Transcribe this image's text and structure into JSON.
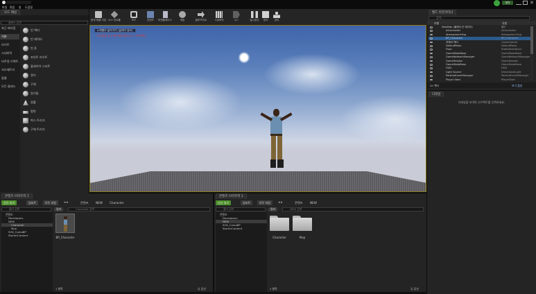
{
  "menu": {
    "items": [
      "파일",
      "편집",
      "창",
      "도움말"
    ]
  },
  "titlebar": {
    "user_badge": "제작"
  },
  "tabs": {
    "modes": "모드 패널",
    "outliner": "월드 아웃라이너",
    "details": "디테일",
    "content_browser_1": "콘텐츠 브라우저 1",
    "content_browser_2": "콘텐츠 브라우저 1"
  },
  "toolbar": {
    "buttons": [
      {
        "label": "현재 레벨 저장",
        "icon": "save-icon"
      },
      {
        "label": "소스 컨트롤",
        "icon": "source-control-icon"
      },
      {
        "label": "모드",
        "icon": "modes-icon"
      },
      {
        "label": "콘텐츠",
        "icon": "content-icon"
      },
      {
        "label": "마켓플레이스",
        "icon": "marketplace-icon"
      },
      {
        "label": "세팅",
        "icon": "settings-icon"
      },
      {
        "label": "블루프린트",
        "icon": "blueprint-icon"
      },
      {
        "label": "시네마틱",
        "icon": "cinematic-icon"
      },
      {
        "label": "빌드",
        "icon": "build-icon"
      },
      {
        "label": "일시정지",
        "icon": "pause-icon"
      },
      {
        "label": "정지",
        "icon": "stop-icon"
      },
      {
        "label": "빙의",
        "icon": "possess-icon"
      }
    ]
  },
  "modes_panel": {
    "search_placeholder": "클래스 검색",
    "categories": [
      "최근 배치함",
      "기본",
      "라이트",
      "시네마틱",
      "비주얼 이펙트",
      "지오메트리",
      "볼륨",
      "모든 클래스"
    ],
    "place_items": [
      "빈 액터",
      "빈 캐릭터",
      "빈 폰",
      "포인트 라이트",
      "플레이어 스타트",
      "큐브",
      "구체",
      "원기둥",
      "원뿔",
      "평면",
      "박스 트리거",
      "구체 트리거"
    ]
  },
  "viewport": {
    "notice": "라이팅을 다시 빌드해야 합니다 (1 오브젝트)",
    "button": "◂ 레벨로 돌아가기 (플레이 종료)"
  },
  "outliner": {
    "search_placeholder": "검색...",
    "col_label": "라벨",
    "col_type": "유형",
    "rows": [
      {
        "name": "NewMap (플레이 인 에디터)",
        "type": "월드"
      },
      {
        "name": "AIController",
        "type": "AIController"
      },
      {
        "name": "AtmosphericFog",
        "type": "AtmosphericFog"
      },
      {
        "name": "BP_Character",
        "type": "BP_Character"
      },
      {
        "name": "카메라 액터",
        "type": "CameraActor"
      },
      {
        "name": "DefaultPawn",
        "type": "DefaultPawn"
      },
      {
        "name": "Floor",
        "type": "StaticMeshActor"
      },
      {
        "name": "GameModeBase",
        "type": "GameModeBase"
      },
      {
        "name": "GameNetworkManager",
        "type": "GameNetworkManager"
      },
      {
        "name": "GameSession",
        "type": "GameSession"
      },
      {
        "name": "GameStateBase",
        "type": "GameStateBase"
      },
      {
        "name": "HUD",
        "type": "HUD"
      },
      {
        "name": "Light Source",
        "type": "DirectionalLight"
      },
      {
        "name": "ParticleEventManager",
        "type": "ParticleEventManager"
      },
      {
        "name": "Player Start",
        "type": "PlayerStart"
      }
    ],
    "footer_count": "20 액터",
    "footer_view": "보기 옵션"
  },
  "details": {
    "empty_text": "디테일을 보려면 오브젝트를 선택하세요."
  },
  "cb1": {
    "add_new": "신규 추가",
    "import": "임포트",
    "save_all": "모두 저장",
    "path": [
      "콘텐츠",
      "NEW",
      "Character"
    ],
    "search_folders": "폴더 검색",
    "filters": "필터",
    "search_assets": "Character 검색",
    "tree": [
      "콘텐츠",
      "Developers",
      "NEW",
      "Character",
      "Map",
      "SOK_ComaBP",
      "StarterContent"
    ],
    "assets": [
      {
        "label": "BP_Character"
      }
    ],
    "item_count": "1 항목",
    "view_options": "뷰 옵션"
  },
  "cb2": {
    "add_new": "신규 추가",
    "import": "임포트",
    "save_all": "모두 저장",
    "path": [
      "콘텐츠",
      "NEW"
    ],
    "search_folders": "폴더 검색",
    "filters": "필터",
    "search_assets": "NEW 검색",
    "tree": [
      "콘텐츠",
      "Developers",
      "NEW",
      "SOK_ComaBP",
      "StarterContent"
    ],
    "assets": [
      {
        "label": "Character"
      },
      {
        "label": "Map"
      }
    ],
    "item_count": "2 항목",
    "view_options": "뷰 옵션"
  },
  "colors": {
    "accent_green": "#4c8e2a",
    "selection_blue": "#2c5a8c",
    "viewport_border": "#8c7a18",
    "notice_red": "#e03a3a"
  }
}
